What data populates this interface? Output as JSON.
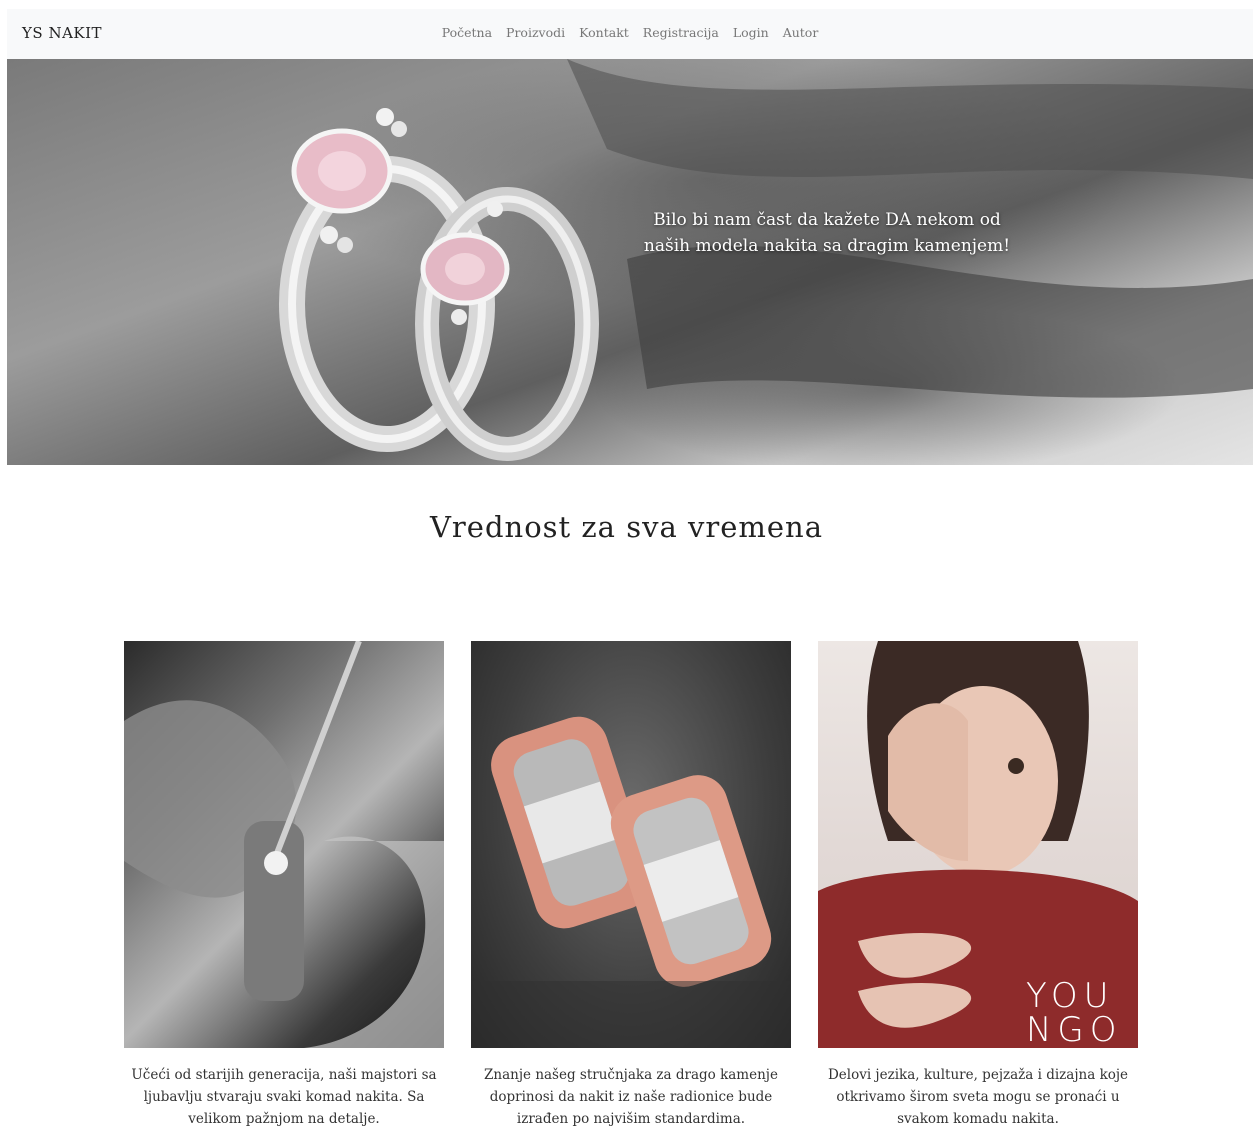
{
  "navbar": {
    "brand": "YS NAKIT",
    "links": [
      "Početna",
      "Proizvodi",
      "Kontakt",
      "Registracija",
      "Login",
      "Autor"
    ]
  },
  "hero": {
    "caption_line1": "Bilo bi nam čast da kažete DA nekom od",
    "caption_line2": "naših modela nakita sa dragim kamenjem!"
  },
  "section": {
    "title": "Vrednost za sva vremena"
  },
  "cards": [
    {
      "text": "Učeći od starijih generacija, naši majstori sa ljubavlju stvaraju svaki komad nakita. Sa velikom pažnjom na detalje."
    },
    {
      "text": "Znanje našeg stručnjaka za drago kamenje doprinosi da nakit iz naše radionice bude izrađen po najvišim standardima."
    },
    {
      "text": "Delovi jezika, kulture, pejzaža i dizajna koje otkrivamo širom sveta mogu se pronaći u svakom komadu nakita.",
      "logo_line1": "YOU",
      "logo_line2": "NGO"
    }
  ],
  "colors": {
    "navbar_bg": "#f8f9fa",
    "nav_link": "#777777",
    "text": "#333333"
  }
}
